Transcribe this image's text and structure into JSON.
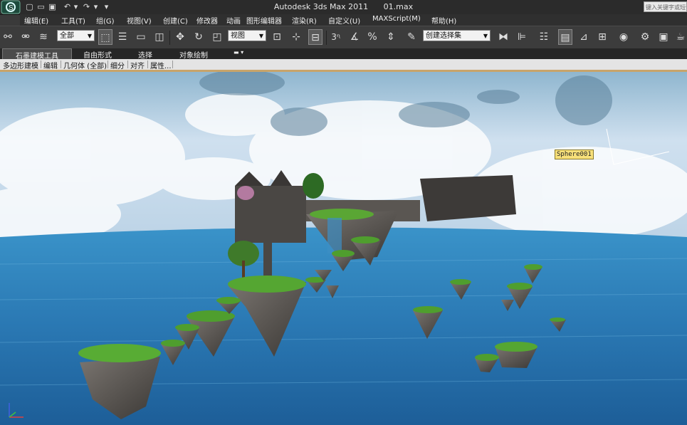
{
  "window": {
    "title": "Autodesk 3ds Max  2011",
    "file": "01.max",
    "search_placeholder": "键入关键字或短语"
  },
  "menu": {
    "items": [
      "编辑(E)",
      "工具(T)",
      "组(G)",
      "视图(V)",
      "创建(C)",
      "修改器",
      "动画",
      "图形编辑器",
      "渲染(R)",
      "自定义(U)",
      "MAXScript(M)",
      "帮助(H)"
    ]
  },
  "toolbar": {
    "selection_filter": "全部",
    "reference_coord": "视图",
    "named_selection_set": "创建选择集",
    "snap_label": "3"
  },
  "ribbon": {
    "tabs": [
      "石墨建模工具",
      "自由形式",
      "选择",
      "对象绘制"
    ],
    "panels": [
      "多边形建模",
      "编辑",
      "几何体 (全部)",
      "细分",
      "对齐",
      "属性..."
    ]
  },
  "viewport": {
    "selected_object_label": "Sphere001",
    "scene": "floating islands over ocean with sky",
    "colors": {
      "sky": "#cfe0ef",
      "ocean": "#2f7fb8",
      "grass": "#4a9a2a",
      "rock": "#5d5a57"
    }
  }
}
